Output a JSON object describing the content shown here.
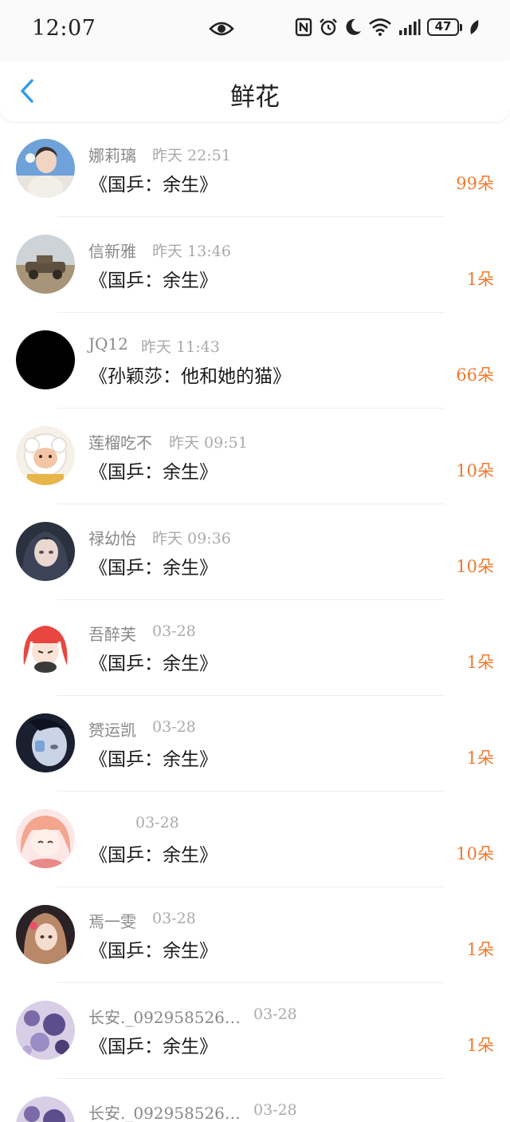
{
  "status_bar": {
    "time": "12:07",
    "battery": "47",
    "icons": [
      "eye-icon",
      "nfc-icon",
      "alarm-icon",
      "moon-icon",
      "wifi-icon",
      "signal-icon",
      "battery-icon",
      "leaf-icon"
    ]
  },
  "header": {
    "title": "鲜花",
    "back_icon": "chevron-left-icon",
    "accent_color": "#2f9bea"
  },
  "flower_color": "#ee7a2f",
  "records": [
    {
      "name": "娜莉璃",
      "time": "昨天 22:51",
      "book": "《国乒：余生》",
      "count": "99朵"
    },
    {
      "name": "信新雅",
      "time": "昨天 13:46",
      "book": "《国乒：余生》",
      "count": "1朵"
    },
    {
      "name": "JQ12",
      "time": "昨天 11:43",
      "book": "《孙颖莎：他和她的猫》",
      "count": "66朵"
    },
    {
      "name": "莲榴吃不",
      "time": "昨天 09:51",
      "book": "《国乒：余生》",
      "count": "10朵"
    },
    {
      "name": "禄幼怡",
      "time": "昨天 09:36",
      "book": "《国乒：余生》",
      "count": "10朵"
    },
    {
      "name": "吾醉芙",
      "time": "03-28",
      "book": "《国乒：余生》",
      "count": "1朵"
    },
    {
      "name": "赟运凯",
      "time": "03-28",
      "book": "《国乒：余生》",
      "count": "1朵"
    },
    {
      "name": "",
      "time": "03-28",
      "book": "《国乒：余生》",
      "count": "10朵"
    },
    {
      "name": "焉一雯",
      "time": "03-28",
      "book": "《国乒：余生》",
      "count": "1朵"
    },
    {
      "name": "长安._092958526…",
      "time": "03-28",
      "book": "《国乒：余生》",
      "count": "1朵"
    },
    {
      "name": "长安._092958526…",
      "time": "03-28",
      "book": "",
      "count": ""
    }
  ]
}
